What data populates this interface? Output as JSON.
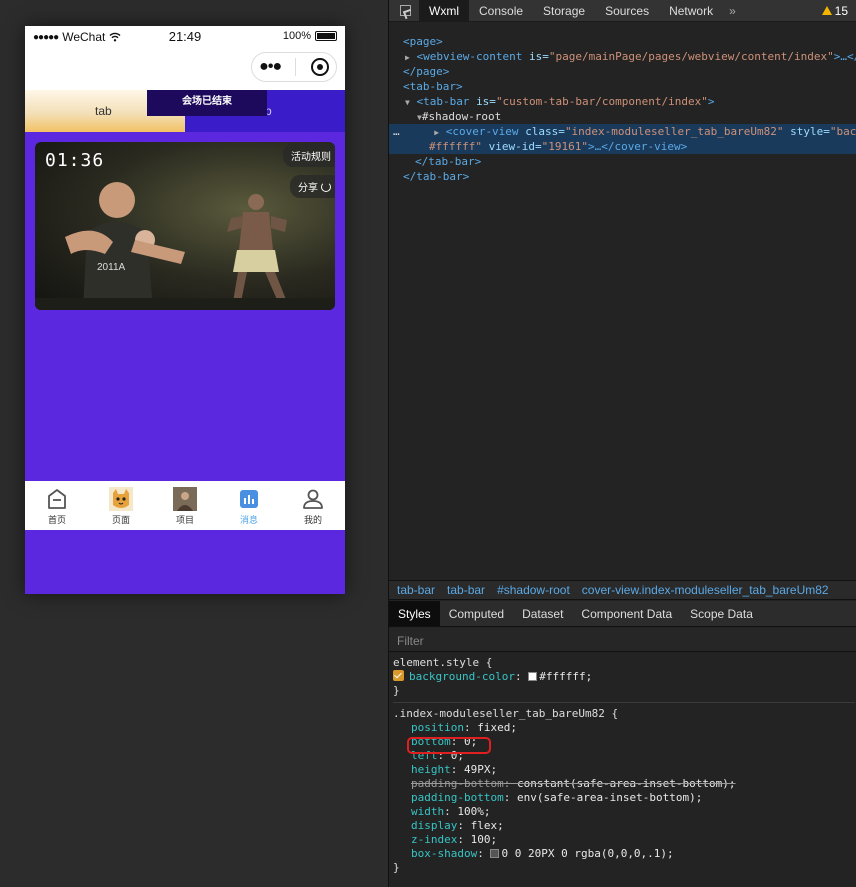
{
  "simulator": {
    "status_bar": {
      "carrier": "WeChat",
      "time": "21:49",
      "battery": "100%"
    },
    "top_tabs": {
      "left_label": "tab",
      "right_label": "tab",
      "banner": "会场已结束"
    },
    "video": {
      "countdown": "01:36",
      "rules_button": "活动规则",
      "share_button": "分享"
    },
    "tab_bar": [
      {
        "label": "首页",
        "icon": "home-icon"
      },
      {
        "label": "页面",
        "icon": "cat-avatar-icon"
      },
      {
        "label": "项目",
        "icon": "photo-avatar-icon"
      },
      {
        "label": "消息",
        "icon": "chart-icon",
        "active": true
      },
      {
        "label": "我的",
        "icon": "user-icon"
      }
    ]
  },
  "devtools": {
    "tabs": [
      "Wxml",
      "Console",
      "Storage",
      "Sources",
      "Network"
    ],
    "warning_count": "15",
    "dom": {
      "l1": "<page>",
      "l2_tag": "<webview-content",
      "l2_attr": "is=",
      "l2_val": "\"page/mainPage/pages/webview/content/index\"",
      "l2_tail": ">…</",
      "l3": "</page>",
      "l4": "<tab-bar>",
      "l5_tag": "<tab-bar",
      "l5_attr": "is=",
      "l5_val": "\"custom-tab-bar/component/index\"",
      "l5_tail": ">",
      "l6": "#shadow-root",
      "l7_tag": "<cover-view",
      "l7_attr": "class=",
      "l7_val": "\"index-moduleseller_tab_bareUm82\"",
      "l7_attr2": "style=",
      "l7_val2": "\"back",
      "l8_val": "#ffffff\"",
      "l8_attr": "view-id=",
      "l8_val2": "\"19161\"",
      "l8_tail": ">…</cover-view>",
      "l9": "</tab-bar>",
      "l10": "</tab-bar>"
    },
    "breadcrumb": [
      "tab-bar",
      "tab-bar",
      "#shadow-root",
      "cover-view.index-moduleseller_tab_bareUm82"
    ],
    "sub_tabs": [
      "Styles",
      "Computed",
      "Dataset",
      "Component Data",
      "Scope Data"
    ],
    "filter_placeholder": "Filter",
    "styles": {
      "element_selector": "element.style {",
      "bg_prop": "background-color",
      "bg_val": "#ffffff;",
      "close": "}",
      "class_selector": ".index-moduleseller_tab_bareUm82 {",
      "rules": [
        {
          "prop": "position",
          "val": "fixed;"
        },
        {
          "prop": "bottom",
          "val": "0;"
        },
        {
          "prop": "left",
          "val": "0;"
        },
        {
          "prop": "height",
          "val": "49PX;"
        },
        {
          "prop": "padding-bottom",
          "val": "constant(safe-area-inset-bottom);",
          "struck": true
        },
        {
          "prop": "padding-bottom",
          "val": "env(safe-area-inset-bottom);"
        },
        {
          "prop": "width",
          "val": "100%;"
        },
        {
          "prop": "display",
          "val": "flex;"
        },
        {
          "prop": "z-index",
          "val": "100;"
        },
        {
          "prop": "box-shadow",
          "val": "0 0 20PX 0 rgba(0,0,0,.1);"
        }
      ]
    }
  }
}
